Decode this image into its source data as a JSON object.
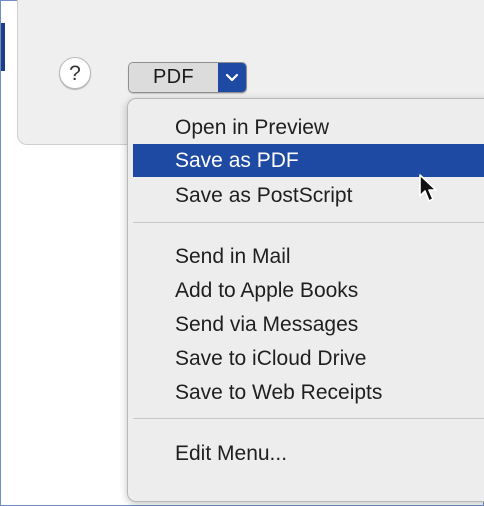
{
  "toolbar": {
    "help_glyph": "?",
    "pdf_label": "PDF",
    "pdf_menu_icon": "chevron-down-icon",
    "help_icon": "question-icon"
  },
  "menu": {
    "items": [
      {
        "label": "Open in Preview"
      },
      {
        "label": "Save as PDF",
        "selected": true
      },
      {
        "label": "Save as PostScript"
      },
      {
        "label": "Send in Mail"
      },
      {
        "label": "Add to Apple Books"
      },
      {
        "label": "Send via Messages"
      },
      {
        "label": "Save to iCloud Drive"
      },
      {
        "label": "Save to Web Receipts"
      },
      {
        "label": "Edit Menu..."
      }
    ]
  },
  "colors": {
    "accent": "#1f4aa3",
    "menu_background": "#ededed",
    "dialog_background": "#efefef",
    "frame_border": "#6f8ec4"
  }
}
